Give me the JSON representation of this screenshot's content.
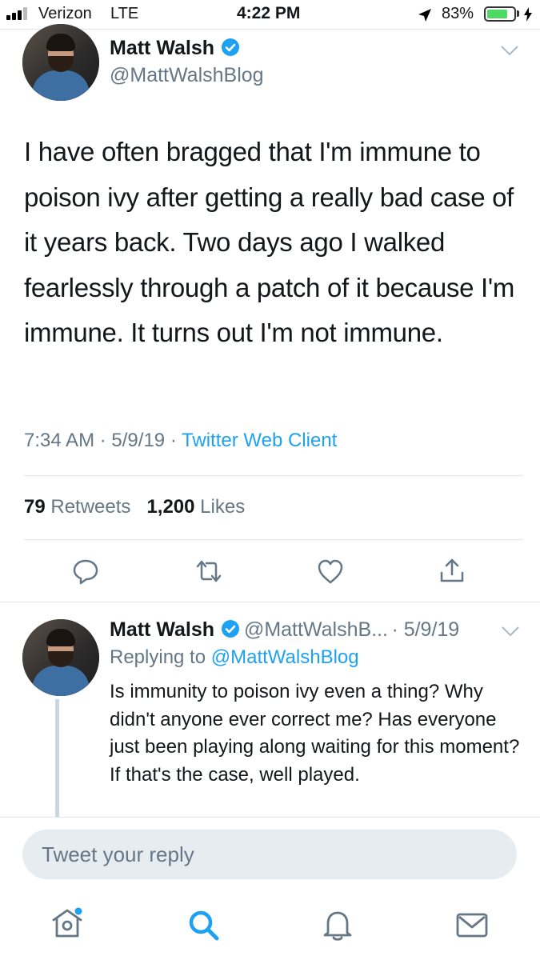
{
  "status_bar": {
    "carrier": "Verizon",
    "network": "LTE",
    "time": "4:22 PM",
    "battery_percent": "83%",
    "battery_level": 0.83
  },
  "tweet": {
    "author_name": "Matt Walsh",
    "author_handle": "@MattWalshBlog",
    "text": "I have often bragged that I'm immune to poison ivy after getting a really bad case of it years back. Two days ago I walked fearlessly through a patch of it because I'm immune. It turns out I'm not immune.",
    "time": "7:34 AM",
    "date": "5/9/19",
    "separator": "·",
    "source": "Twitter Web Client",
    "retweets_count": "79",
    "retweets_label": "Retweets",
    "likes_count": "1,200",
    "likes_label": "Likes"
  },
  "reply": {
    "author_name": "Matt Walsh",
    "author_handle": "@MattWalshB...",
    "date": "· 5/9/19",
    "replying_to_label": "Replying to",
    "replying_to_handle": "@MattWalshBlog",
    "text": "Is immunity to poison ivy even a thing? Why didn't anyone ever correct me? Has everyone just been playing along waiting for this moment? If that's the case, well played."
  },
  "compose": {
    "placeholder": "Tweet your reply"
  },
  "colors": {
    "accent": "#1da1f2",
    "muted": "#657786",
    "divider": "#e1e8ed"
  },
  "icons": {
    "actions": [
      "reply-icon",
      "retweet-icon",
      "like-icon",
      "share-icon"
    ],
    "tabs": [
      "home-icon",
      "search-icon",
      "notifications-icon",
      "messages-icon"
    ]
  }
}
